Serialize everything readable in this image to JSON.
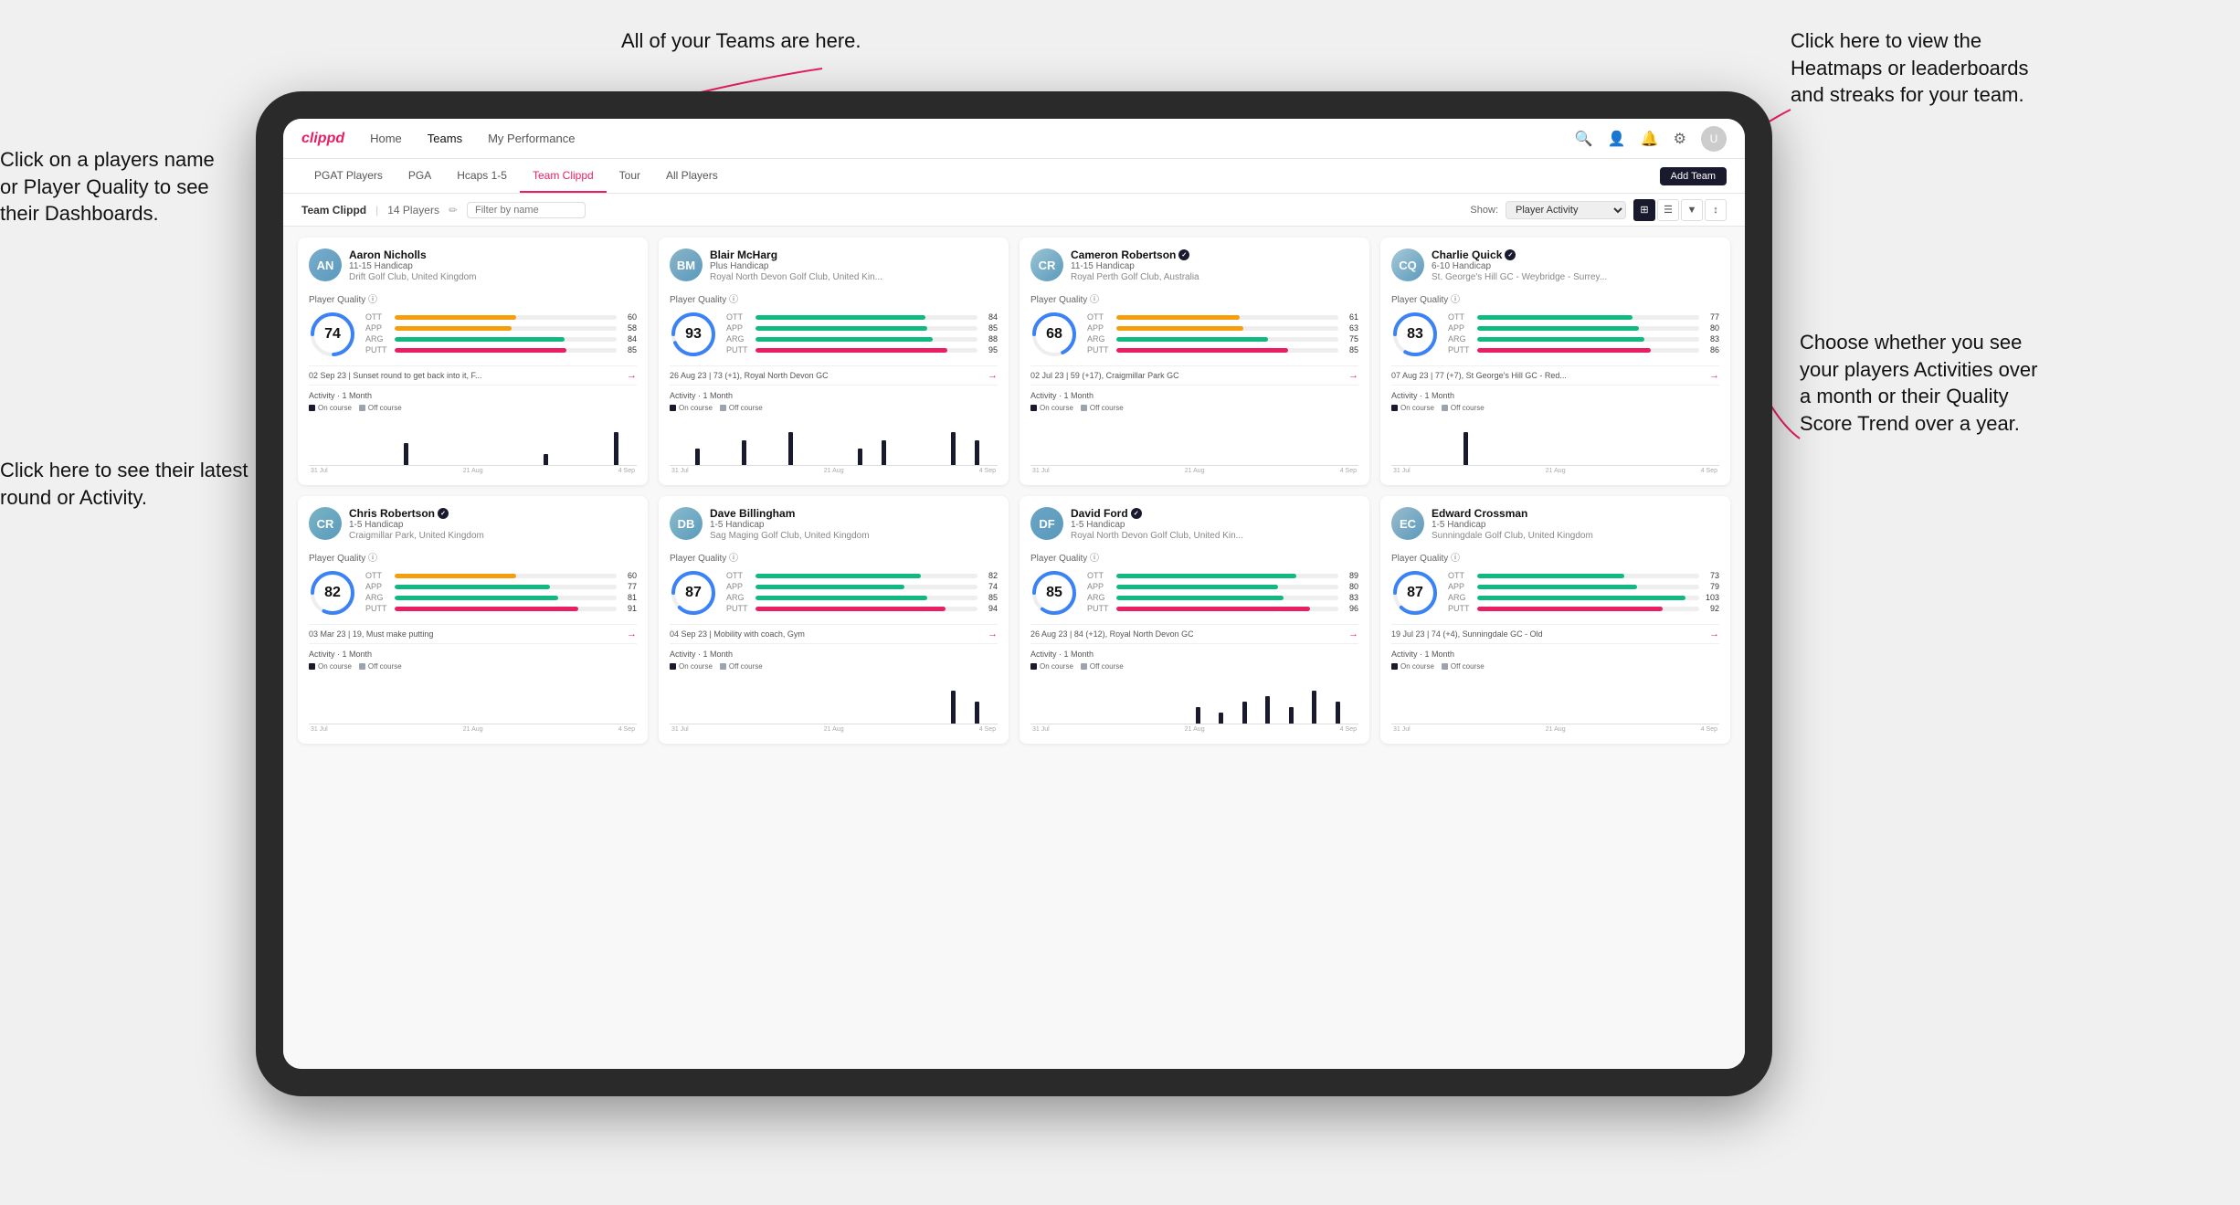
{
  "app": {
    "brand": "clippd",
    "nav_links": [
      "Home",
      "Teams",
      "My Performance"
    ],
    "nav_active": "Teams",
    "icons": [
      "search",
      "person",
      "bell",
      "settings",
      "avatar"
    ]
  },
  "subnav": {
    "tabs": [
      "PGAT Players",
      "PGA",
      "Hcaps 1-5",
      "Team Clippd",
      "Tour",
      "All Players"
    ],
    "active": "Team Clippd",
    "add_btn": "Add Team"
  },
  "teambar": {
    "team_name": "Team Clippd",
    "player_count": "14 Players",
    "show_label": "Show:",
    "show_option": "Player Activity",
    "filter_placeholder": "Filter by name"
  },
  "annotations": {
    "ann1_title": "Click on a players name\nor Player Quality to see\ntheir Dashboards.",
    "ann2_title": "Click here to see their latest\nround or Activity.",
    "ann3_title": "Click here to view the\nHeatmaps or leaderboards\nand streaks for your team.",
    "ann4_title": "Choose whether you see\nyour players Activities over\na month or their Quality\nScore Trend over a year.",
    "ann5_title": "All of your Teams are here."
  },
  "players": [
    {
      "name": "Aaron Nicholls",
      "handicap": "11-15 Handicap",
      "club": "Drift Golf Club, United Kingdom",
      "quality": 74,
      "quality_color": "#3b82f6",
      "initials": "AN",
      "avatar_color": "#7aaccc",
      "stats": [
        {
          "name": "OTT",
          "value": 60,
          "color": "#f59e0b"
        },
        {
          "name": "APP",
          "value": 58,
          "color": "#f59e0b"
        },
        {
          "name": "ARG",
          "value": 84,
          "color": "#10b981"
        },
        {
          "name": "PUTT",
          "value": 85,
          "color": "#e91e63"
        }
      ],
      "recent": "02 Sep 23 | Sunset round to get back into it, F...",
      "chart_bars": [
        0,
        0,
        0,
        0,
        2,
        0,
        0,
        0,
        0,
        0,
        1,
        0,
        0,
        3
      ],
      "verified": false
    },
    {
      "name": "Blair McHarg",
      "handicap": "Plus Handicap",
      "club": "Royal North Devon Golf Club, United Kin...",
      "quality": 93,
      "quality_color": "#3b82f6",
      "initials": "BM",
      "avatar_color": "#8ab4c8",
      "stats": [
        {
          "name": "OTT",
          "value": 84,
          "color": "#10b981"
        },
        {
          "name": "APP",
          "value": 85,
          "color": "#10b981"
        },
        {
          "name": "ARG",
          "value": 88,
          "color": "#10b981"
        },
        {
          "name": "PUTT",
          "value": 95,
          "color": "#e91e63"
        }
      ],
      "recent": "26 Aug 23 | 73 (+1), Royal North Devon GC",
      "chart_bars": [
        0,
        2,
        0,
        3,
        0,
        4,
        0,
        0,
        2,
        3,
        0,
        0,
        4,
        3
      ],
      "verified": false
    },
    {
      "name": "Cameron Robertson",
      "handicap": "11-15 Handicap",
      "club": "Royal Perth Golf Club, Australia",
      "quality": 68,
      "quality_color": "#3b82f6",
      "initials": "CR",
      "avatar_color": "#9bc4d4",
      "stats": [
        {
          "name": "OTT",
          "value": 61,
          "color": "#f59e0b"
        },
        {
          "name": "APP",
          "value": 63,
          "color": "#f59e0b"
        },
        {
          "name": "ARG",
          "value": 75,
          "color": "#10b981"
        },
        {
          "name": "PUTT",
          "value": 85,
          "color": "#e91e63"
        }
      ],
      "recent": "02 Jul 23 | 59 (+17), Craigmillar Park GC",
      "chart_bars": [
        0,
        0,
        0,
        0,
        0,
        0,
        0,
        0,
        0,
        0,
        0,
        0,
        0,
        0
      ],
      "verified": true
    },
    {
      "name": "Charlie Quick",
      "handicap": "6-10 Handicap",
      "club": "St. George's Hill GC - Weybridge - Surrey...",
      "quality": 83,
      "quality_color": "#3b82f6",
      "initials": "CQ",
      "avatar_color": "#a8c8d8",
      "stats": [
        {
          "name": "OTT",
          "value": 77,
          "color": "#10b981"
        },
        {
          "name": "APP",
          "value": 80,
          "color": "#10b981"
        },
        {
          "name": "ARG",
          "value": 83,
          "color": "#10b981"
        },
        {
          "name": "PUTT",
          "value": 86,
          "color": "#e91e63"
        }
      ],
      "recent": "07 Aug 23 | 77 (+7), St George's Hill GC - Red...",
      "chart_bars": [
        0,
        0,
        0,
        2,
        0,
        0,
        0,
        0,
        0,
        0,
        0,
        0,
        0,
        0
      ],
      "verified": true
    },
    {
      "name": "Chris Robertson",
      "handicap": "1-5 Handicap",
      "club": "Craigmillar Park, United Kingdom",
      "quality": 82,
      "quality_color": "#3b82f6",
      "initials": "CR",
      "avatar_color": "#7ab4c4",
      "stats": [
        {
          "name": "OTT",
          "value": 60,
          "color": "#f59e0b"
        },
        {
          "name": "APP",
          "value": 77,
          "color": "#10b981"
        },
        {
          "name": "ARG",
          "value": 81,
          "color": "#10b981"
        },
        {
          "name": "PUTT",
          "value": 91,
          "color": "#e91e63"
        }
      ],
      "recent": "03 Mar 23 | 19, Must make putting",
      "chart_bars": [
        0,
        0,
        0,
        0,
        0,
        0,
        0,
        0,
        0,
        0,
        0,
        0,
        0,
        0
      ],
      "verified": true
    },
    {
      "name": "Dave Billingham",
      "handicap": "1-5 Handicap",
      "club": "Sag Maging Golf Club, United Kingdom",
      "quality": 87,
      "quality_color": "#3b82f6",
      "initials": "DB",
      "avatar_color": "#8abccc",
      "stats": [
        {
          "name": "OTT",
          "value": 82,
          "color": "#10b981"
        },
        {
          "name": "APP",
          "value": 74,
          "color": "#10b981"
        },
        {
          "name": "ARG",
          "value": 85,
          "color": "#10b981"
        },
        {
          "name": "PUTT",
          "value": 94,
          "color": "#e91e63"
        }
      ],
      "recent": "04 Sep 23 | Mobility with coach, Gym",
      "chart_bars": [
        0,
        0,
        0,
        0,
        0,
        0,
        0,
        0,
        0,
        0,
        0,
        0,
        3,
        2
      ],
      "verified": false
    },
    {
      "name": "David Ford",
      "handicap": "1-5 Handicap",
      "club": "Royal North Devon Golf Club, United Kin...",
      "quality": 85,
      "quality_color": "#3b82f6",
      "initials": "DF",
      "avatar_color": "#6aa4c4",
      "stats": [
        {
          "name": "OTT",
          "value": 89,
          "color": "#10b981"
        },
        {
          "name": "APP",
          "value": 80,
          "color": "#10b981"
        },
        {
          "name": "ARG",
          "value": 83,
          "color": "#10b981"
        },
        {
          "name": "PUTT",
          "value": 96,
          "color": "#e91e63"
        }
      ],
      "recent": "26 Aug 23 | 84 (+12), Royal North Devon GC",
      "chart_bars": [
        0,
        0,
        0,
        0,
        0,
        0,
        0,
        3,
        2,
        4,
        5,
        3,
        6,
        4
      ],
      "verified": true
    },
    {
      "name": "Edward Crossman",
      "handicap": "1-5 Handicap",
      "club": "Sunningdale Golf Club, United Kingdom",
      "quality": 87,
      "quality_color": "#3b82f6",
      "initials": "EC",
      "avatar_color": "#9abccc",
      "stats": [
        {
          "name": "OTT",
          "value": 73,
          "color": "#10b981"
        },
        {
          "name": "APP",
          "value": 79,
          "color": "#10b981"
        },
        {
          "name": "ARG",
          "value": 103,
          "color": "#10b981"
        },
        {
          "name": "PUTT",
          "value": 92,
          "color": "#e91e63"
        }
      ],
      "recent": "19 Jul 23 | 74 (+4), Sunningdale GC - Old",
      "chart_bars": [
        0,
        0,
        0,
        0,
        0,
        0,
        0,
        0,
        0,
        0,
        0,
        0,
        0,
        0
      ],
      "verified": false
    }
  ],
  "chart_axis_labels": [
    "31 Jul",
    "21 Aug",
    "4 Sep"
  ],
  "activity_legend": {
    "on_course": "On course",
    "off_course": "Off course",
    "on_color": "#1a1a2e",
    "off_color": "#9ca3af"
  }
}
